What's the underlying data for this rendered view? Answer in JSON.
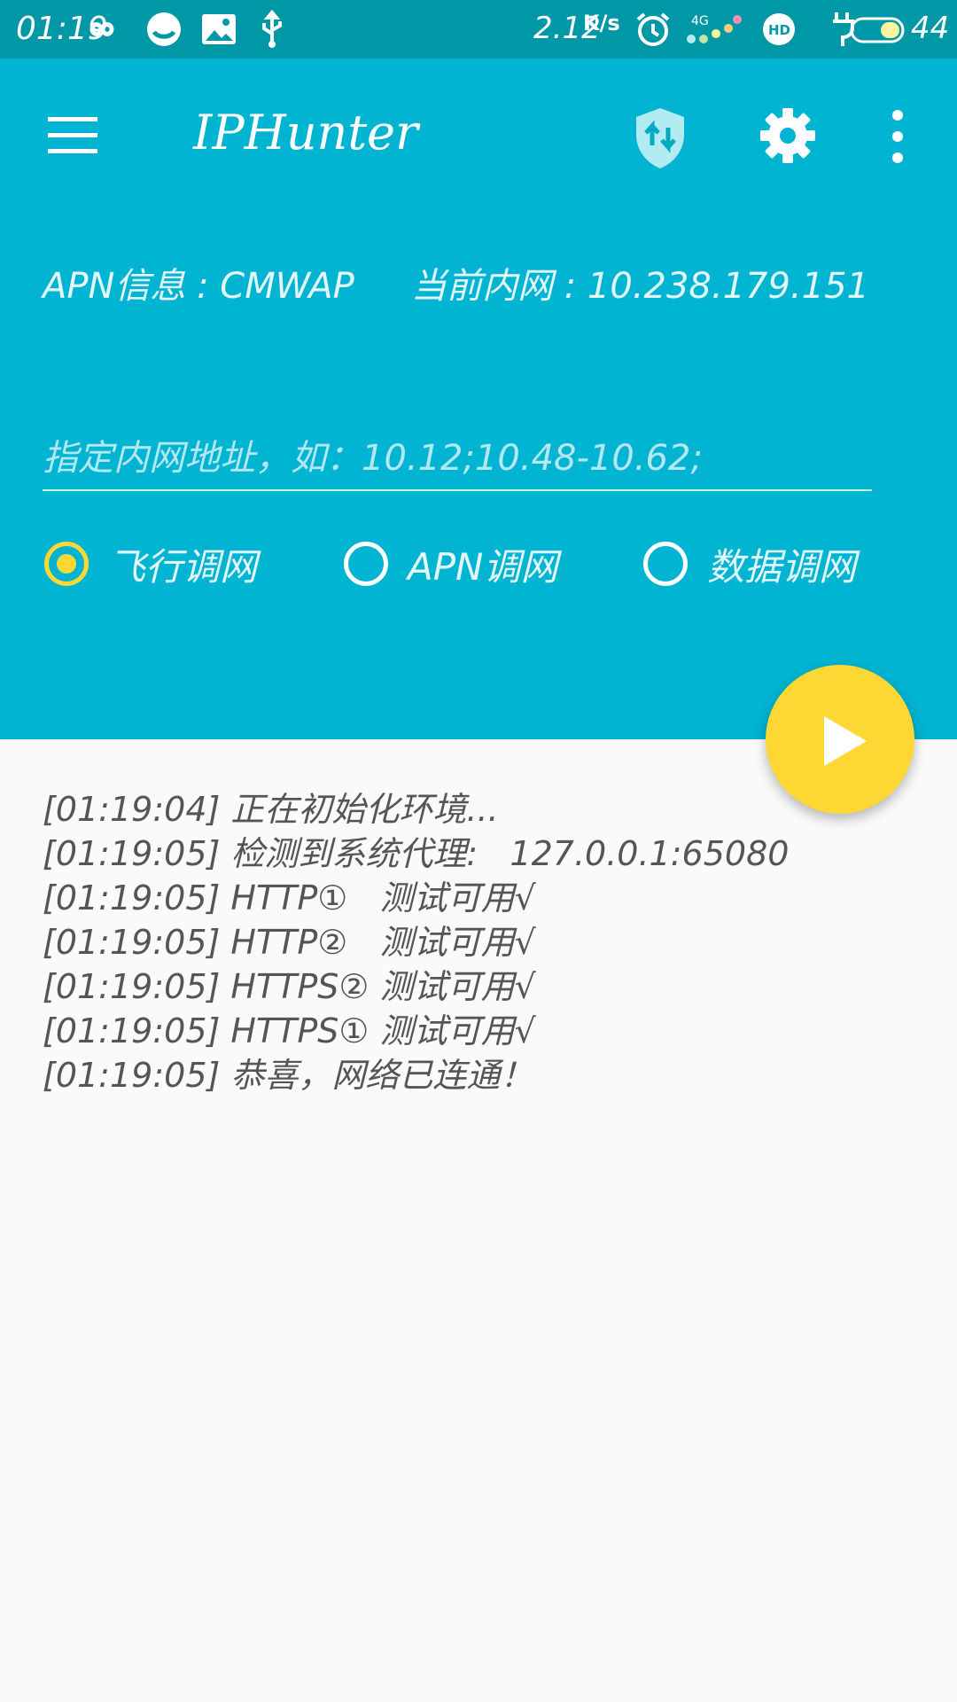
{
  "status_bar": {
    "time": "01:19",
    "net_speed": "2.12",
    "net_speed_unit": "K/s",
    "battery": "44",
    "icons": [
      "infinity-icon",
      "app-icon",
      "image-icon",
      "usb-icon",
      "alarm-icon",
      "signal-4g-icon",
      "hd-icon",
      "charging-icon",
      "battery-icon"
    ]
  },
  "header": {
    "title": "IPHunter",
    "icons": [
      "menu-icon",
      "shield-transfer-icon",
      "gear-icon",
      "more-vert-icon"
    ]
  },
  "info": {
    "apn": "APN信息 : CMWAP",
    "lan": "当前内网 : 10.238.179.151"
  },
  "lan_input": {
    "value": "",
    "placeholder": "指定内网地址，如：10.12;10.48-10.62;"
  },
  "modes": [
    {
      "label": "飞行调网",
      "checked": true
    },
    {
      "label": "APN调网",
      "checked": false
    },
    {
      "label": "数据调网",
      "checked": false
    }
  ],
  "fab": {
    "icon": "play-icon"
  },
  "log": [
    "[01:19:04] 正在初始化环境...",
    "[01:19:05] 检测到系统代理:   127.0.0.1:65080",
    "[01:19:05] HTTP①   测试可用√",
    "[01:19:05] HTTP②   测试可用√",
    "[01:19:05] HTTPS② 测试可用√",
    "[01:19:05] HTTPS① 测试可用√",
    "[01:19:05] 恭喜，网络已连通！"
  ],
  "colors": {
    "status_bar": "#0097a7",
    "header": "#00b4d2",
    "accent": "#fdd835",
    "background": "#fafafa"
  }
}
